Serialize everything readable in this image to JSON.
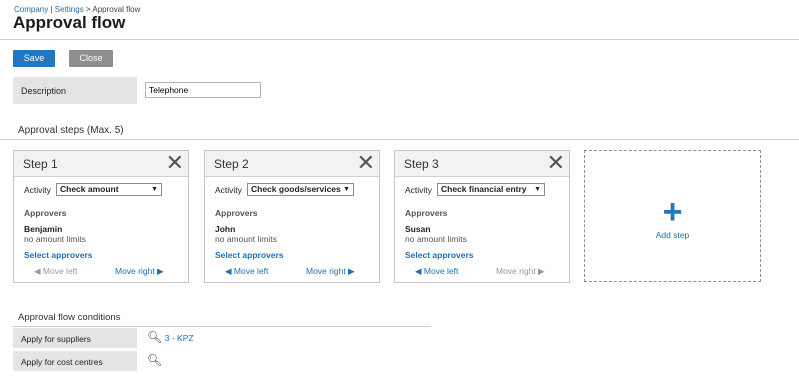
{
  "breadcrumb": {
    "company": "Company",
    "sep1": " | ",
    "settings": "Settings",
    "sep2": " > ",
    "current": "Approval flow"
  },
  "page_title": "Approval flow",
  "toolbar": {
    "save_label": "Save",
    "close_label": "Close"
  },
  "description": {
    "label": "Description",
    "value": "Telephone"
  },
  "steps_title": "Approval steps (Max. 5)",
  "steps": [
    {
      "title": "Step 1",
      "activity_label": "Activity",
      "activity_value": "Check amount",
      "approvers_heading": "Approvers",
      "approver_name": "Benjamin",
      "approver_limit": "no amount limits",
      "select_label": "Select approvers",
      "move_left": "Move left",
      "move_right": "Move right",
      "left_enabled": false,
      "right_enabled": true
    },
    {
      "title": "Step 2",
      "activity_label": "Activity",
      "activity_value": "Check goods/services",
      "approvers_heading": "Approvers",
      "approver_name": "John",
      "approver_limit": "no amount limits",
      "select_label": "Select approvers",
      "move_left": "Move left",
      "move_right": "Move right",
      "left_enabled": true,
      "right_enabled": true
    },
    {
      "title": "Step 3",
      "activity_label": "Activity",
      "activity_value": "Check financial entry",
      "approvers_heading": "Approvers",
      "approver_name": "Susan",
      "approver_limit": "no amount limits",
      "select_label": "Select approvers",
      "move_left": "Move left",
      "move_right": "Move right",
      "left_enabled": true,
      "right_enabled": false
    }
  ],
  "add_step": {
    "label": "Add step",
    "icon": "plus-icon"
  },
  "conditions": {
    "title": "Approval flow conditions",
    "suppliers_label": "Apply for suppliers",
    "suppliers_value": "3 - KPZ",
    "cost_centres_label": "Apply for cost centres"
  },
  "colors": {
    "accent": "#1f78c1",
    "link": "#1f6fb5",
    "label_bg": "#e4e4e4",
    "close_button": "#8e8e8e"
  }
}
